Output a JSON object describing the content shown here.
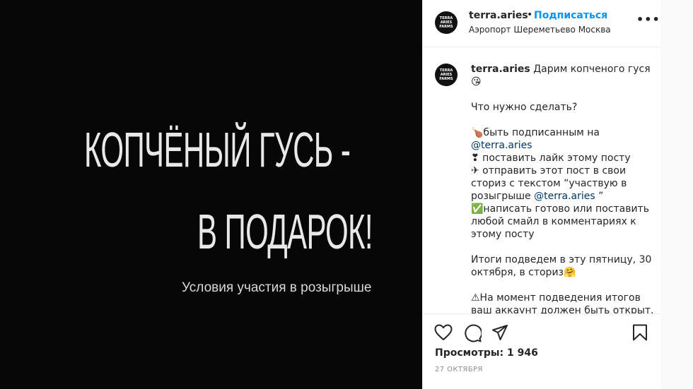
{
  "media": {
    "line1": "КОПЧЁНЫЙ ГУСЬ -",
    "line2": "В ПОДАРОК!",
    "line3": "Условия участия в розыгрыше"
  },
  "header": {
    "avatar_text": [
      "TERRA",
      "ARIES",
      "FARMS"
    ],
    "username": "terra.aries",
    "separator": "•",
    "follow_label": "Подписаться",
    "location": "Аэропорт Шереметьево Москва",
    "more_label": "•••"
  },
  "caption": {
    "username": "terra.aries",
    "intro": "Дарим копченого гуся😘",
    "question": "Что нужно сделать?",
    "step1_prefix": "🍗быть подписанным на",
    "step1_link": "@terra.aries",
    "step2": "❣ поставить лайк этому посту",
    "step3_a": "✈ отправить этот пост в свои",
    "step3_b": "сториз с текстом “участвую в",
    "step3_c_prefix": "розыгрыше",
    "step3_link": "@terra.aries",
    "step3_c_suffix": "”",
    "step4_a": "✅написать готово или поставить",
    "step4_b": "любой смайл в комментариях к",
    "step4_c": "этому посту",
    "results_a": "Итоги подведем в эту пятницу, 30",
    "results_b": "октября, в сториз🤗",
    "warning_a": "⚠На момент подведения итогов",
    "warning_b": "ваш аккаунт должен быть открыт."
  },
  "actions": {
    "like_icon": "heart-icon",
    "comment_icon": "comment-icon",
    "share_icon": "paper-plane-icon",
    "save_icon": "bookmark-icon"
  },
  "stats": {
    "views": "Просмотры: 1 946",
    "date": "27 ОКТЯБРЯ"
  },
  "colors": {
    "accent": "#0095f6",
    "link": "#00376b",
    "media_bg": "#070707"
  }
}
